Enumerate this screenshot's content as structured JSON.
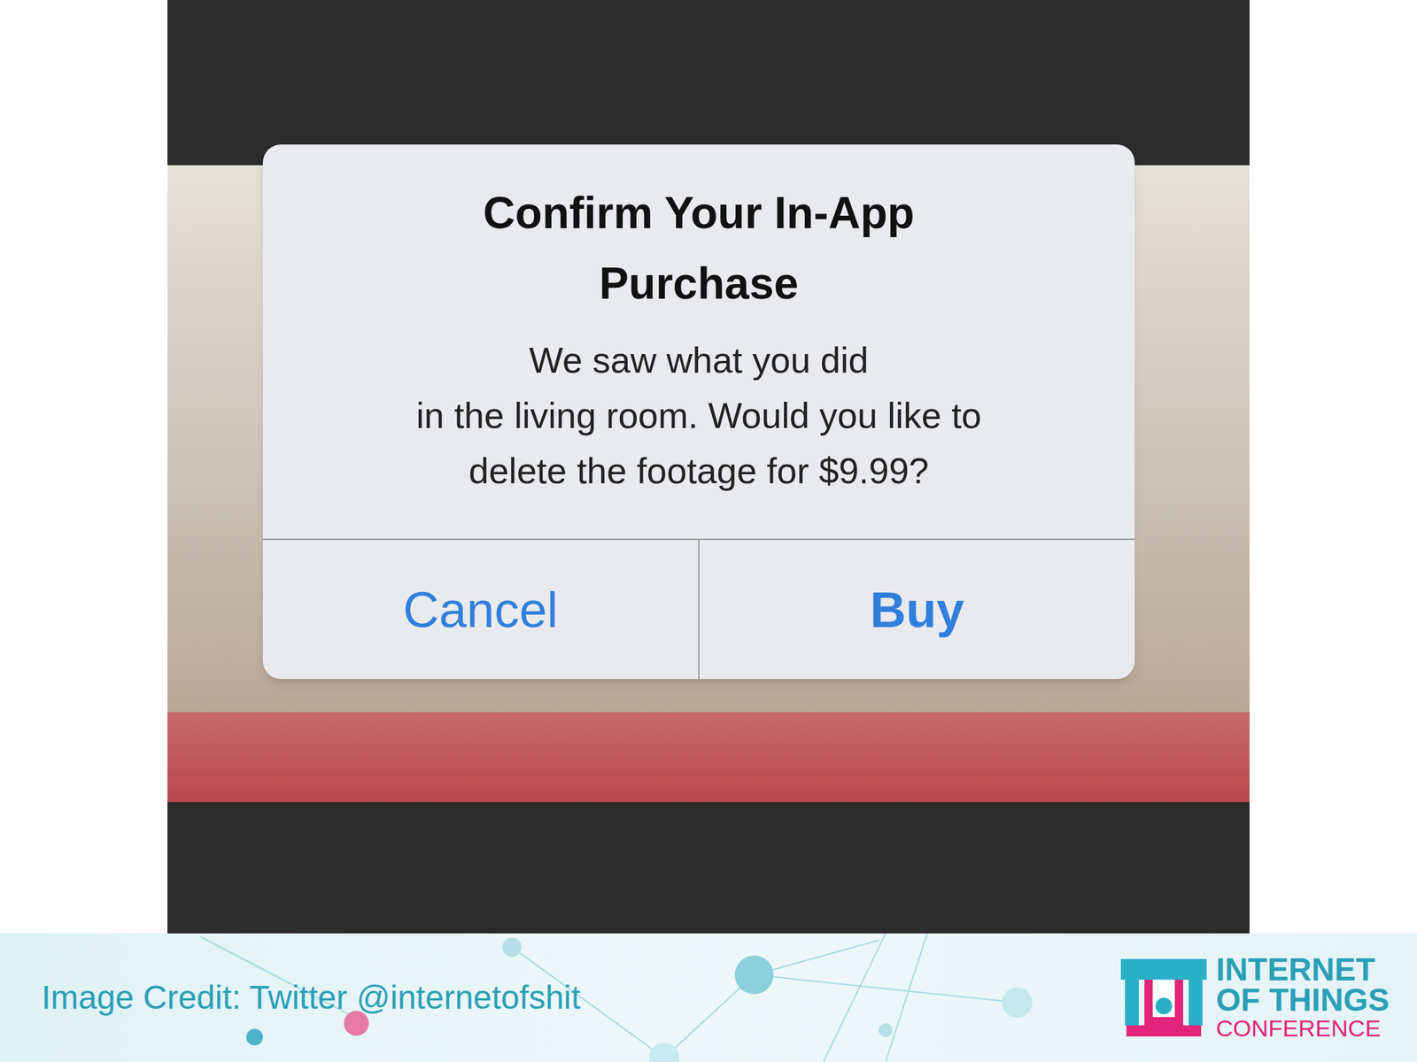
{
  "slide": {
    "image": {
      "dialog": {
        "title_lines": [
          "Confirm Your In-App",
          "Purchase"
        ],
        "message_lines": [
          "We saw what you did",
          "in the living room. Would you like to",
          "delete the footage for $9.99?"
        ],
        "buttons": [
          {
            "label": "Cancel",
            "primary": false
          },
          {
            "label": "Buy",
            "primary": true
          }
        ]
      }
    },
    "credit": "Image Credit: Twitter @internetofshit",
    "logo": {
      "lines": [
        "INTERNET",
        "OF THINGS",
        "CONFERENCE"
      ]
    }
  }
}
